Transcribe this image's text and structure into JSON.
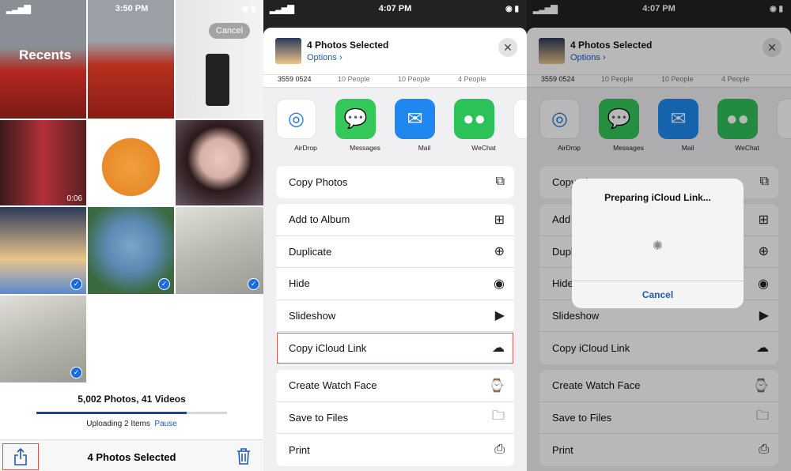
{
  "panel1": {
    "status_time": "3:50 PM",
    "title": "Recents",
    "cancel": "Cancel",
    "video_duration": "0:06",
    "counts": "5,002 Photos, 41 Videos",
    "upload_progress": 0.79,
    "uploading": "Uploading 2 Items",
    "pause": "Pause",
    "toolbar_title": "4 Photos Selected",
    "selected_count": 4
  },
  "share": {
    "status_time": "4:07 PM",
    "title": "4 Photos Selected",
    "options": "Options",
    "people": [
      "3559 0524",
      "10 People",
      "10 People",
      "4 People"
    ],
    "apps": [
      {
        "label": "AirDrop",
        "icon": "airdrop-icon",
        "color": "#ffffff"
      },
      {
        "label": "Messages",
        "icon": "messages-icon",
        "color": "#34c759"
      },
      {
        "label": "Mail",
        "icon": "mail-icon",
        "color": "#1e88f0"
      },
      {
        "label": "WeChat",
        "icon": "wechat-icon",
        "color": "#2dc15a"
      },
      {
        "label": "We",
        "icon": "weibo-icon",
        "color": "#ffffff"
      }
    ],
    "group1": [
      {
        "label": "Copy Photos",
        "icon": "copy-icon"
      }
    ],
    "group2": [
      {
        "label": "Add to Album",
        "icon": "add-album-icon"
      },
      {
        "label": "Duplicate",
        "icon": "duplicate-icon"
      },
      {
        "label": "Hide",
        "icon": "hide-eye-icon"
      },
      {
        "label": "Slideshow",
        "icon": "play-icon"
      },
      {
        "label": "Copy iCloud Link",
        "icon": "cloud-link-icon"
      }
    ],
    "group3": [
      {
        "label": "Create Watch Face",
        "icon": "watch-icon"
      },
      {
        "label": "Save to Files",
        "icon": "folder-icon"
      },
      {
        "label": "Print",
        "icon": "printer-icon"
      }
    ]
  },
  "alert": {
    "title": "Preparing iCloud Link...",
    "cancel": "Cancel"
  }
}
